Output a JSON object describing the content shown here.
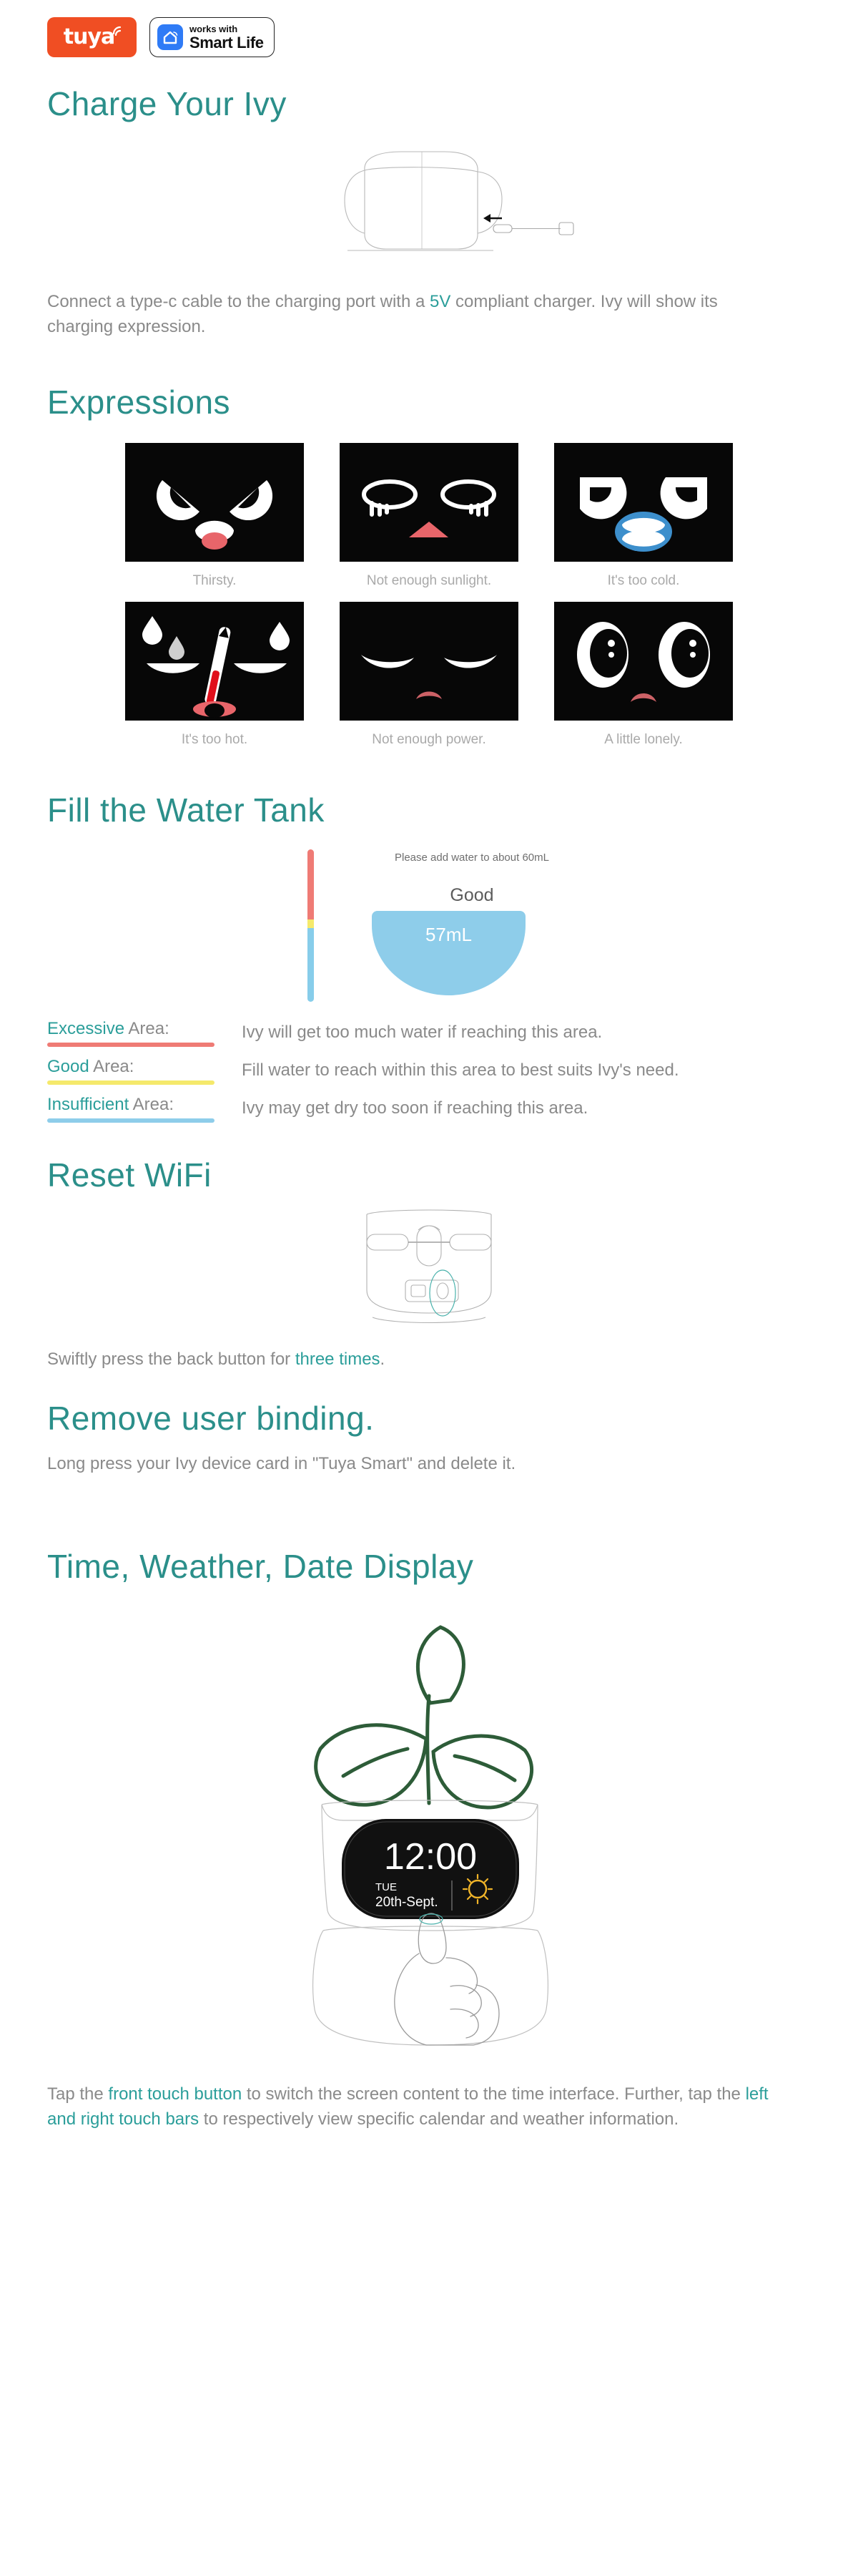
{
  "header": {
    "tuya_logo_text": "tuya",
    "tuya_logo_name": "tuya-logo",
    "smartlife_small": "works with",
    "smartlife_big": "Smart Life"
  },
  "charge": {
    "title": "Charge Your Ivy",
    "caption_pre": "Connect a type-c cable to the charging port with a ",
    "caption_accent": "5V",
    "caption_post": " compliant charger. Ivy will show its charging expression."
  },
  "expressions": {
    "title": "Expressions",
    "items": [
      {
        "caption": "Thirsty.",
        "face": "thirsty"
      },
      {
        "caption": "Not enough sunlight.",
        "face": "no-sunlight"
      },
      {
        "caption": "It's too cold.",
        "face": "too-cold"
      },
      {
        "caption": "It's too hot.",
        "face": "too-hot"
      },
      {
        "caption": "Not enough power.",
        "face": "no-power"
      },
      {
        "caption": "A little lonely.",
        "face": "lonely"
      }
    ]
  },
  "water_tank": {
    "title": "Fill the Water Tank",
    "hint": "Please add water to about 60mL",
    "status": "Good",
    "volume": "57mL",
    "legend": [
      {
        "term_hl": "Excessive",
        "term_rest": " Area:",
        "color": "#ef7b75",
        "desc": "Ivy will get too much water if reaching this area."
      },
      {
        "term_hl": "Good",
        "term_rest": " Area:",
        "color": "#f5e96b",
        "desc": "Fill water to reach within this area to best suits Ivy's need."
      },
      {
        "term_hl": "Insufficient",
        "term_rest": " Area:",
        "color": "#8ecdea",
        "desc": "Ivy may get dry too soon if reaching this area."
      }
    ]
  },
  "reset_wifi": {
    "title": "Reset WiFi",
    "caption_pre": "Swiftly press the back button for ",
    "caption_accent": "three times",
    "caption_post": "."
  },
  "remove_binding": {
    "title": "Remove user binding.",
    "caption": "Long press your Ivy device card in \"Tuya Smart\" and delete it."
  },
  "time_display": {
    "title": "Time, Weather, Date Display",
    "screen_time": "12:00",
    "screen_weekday": "TUE",
    "screen_date": "20th-Sept.",
    "caption_p1": "Tap the ",
    "caption_a1": "front touch button",
    "caption_p2": " to switch the screen content to the time interface. Further, tap the ",
    "caption_a2": "left and right touch bars",
    "caption_p3": " to respectively view specific calendar and weather information."
  },
  "colors": {
    "teal": "#2b8f8a",
    "accent": "#2b9e9a",
    "brand_orange": "#f04e23",
    "smartlife_blue": "#2f7bf6",
    "water_blue": "#8ecdea",
    "warn_red": "#ef7b75",
    "warn_yellow": "#f5e96b",
    "body_gray": "#8a8a8a"
  }
}
